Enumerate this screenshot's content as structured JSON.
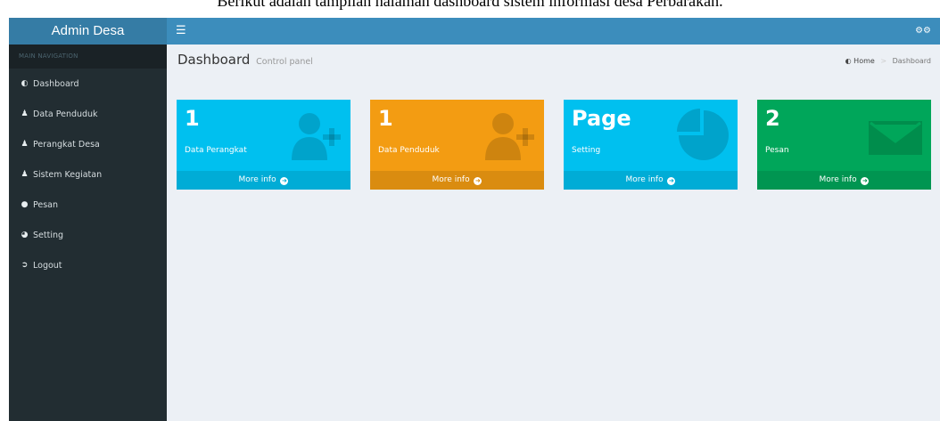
{
  "caption": "Berikut adalah tampilan halaman dashboard sistem informasi desa Perbarakan.",
  "brand": "Admin Desa",
  "navbar": {
    "toggle_icon": "bars-icon",
    "settings_icon": "gears-icon"
  },
  "sidebar": {
    "header": "MAIN NAVIGATION",
    "items": [
      {
        "label": "Dashboard",
        "icon": "dashboard-icon"
      },
      {
        "label": "Data Penduduk",
        "icon": "users-icon"
      },
      {
        "label": "Perangkat Desa",
        "icon": "users-icon"
      },
      {
        "label": "Sistem Kegiatan",
        "icon": "users-icon"
      },
      {
        "label": "Pesan",
        "icon": "comments-icon"
      },
      {
        "label": "Setting",
        "icon": "pie-chart-icon"
      },
      {
        "label": "Logout",
        "icon": "sign-out-icon"
      }
    ]
  },
  "page": {
    "title": "Dashboard",
    "subtitle": "Control panel"
  },
  "breadcrumb": {
    "home": "Home",
    "separator": ">",
    "current": "Dashboard"
  },
  "boxes": [
    {
      "number": "1",
      "label": "Data Perangkat",
      "footer": "More info",
      "icon": "user-plus-icon",
      "color": "#00c0ef",
      "footer_color": "#00acd6"
    },
    {
      "number": "1",
      "label": "Data Penduduk",
      "footer": "More info",
      "icon": "user-plus-icon",
      "color": "#f39c12",
      "footer_color": "#da8c10"
    },
    {
      "number": "Page",
      "label": "Setting",
      "footer": "More info",
      "icon": "pie-chart-icon",
      "color": "#00c0ef",
      "footer_color": "#00acd6"
    },
    {
      "number": "2",
      "label": "Pesan",
      "footer": "More info",
      "icon": "envelope-icon",
      "color": "#00a65a",
      "footer_color": "#009551"
    }
  ]
}
